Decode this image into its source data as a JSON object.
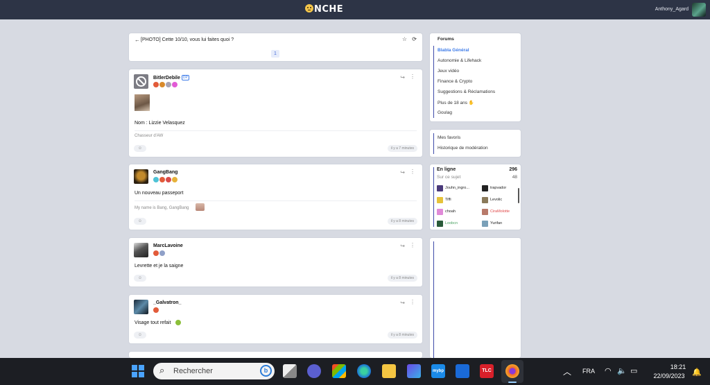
{
  "header": {
    "logo": "NCHE",
    "username": "Anthony_Agard"
  },
  "topic": {
    "back": "←",
    "title": "[PHOTO] Cette 10/10, vous lui faites quoi ?",
    "page": "1",
    "star": "☆",
    "refresh": "⟳"
  },
  "posts": [
    {
      "author": "BitlerDebile",
      "badge": "DP",
      "text": "Nom : Lizzie Velasquez",
      "signature": "Chasseur d'AW",
      "time": "il y a 7 minutes"
    },
    {
      "author": "GangBang",
      "text": "Un nouveau passeport",
      "signature": "My name is Bang, GangBang",
      "time": "il y a 8 minutes"
    },
    {
      "author": "MarcLavoine",
      "text": "Levrette et je la saigne",
      "time": "il y a 8 minutes"
    },
    {
      "author": "_Galvatron_",
      "text": "Visage tout refait",
      "time": "il y a 8 minutes"
    }
  ],
  "icons": {
    "share": "↪",
    "more": "⋮",
    "react": "☺"
  },
  "forums": {
    "heading": "Forums",
    "items": [
      "Blabla Général",
      "Autonomie & Lifehack",
      "Jeux vidéo",
      "Finance & Crypto",
      "Suggestions & Réclamations",
      "Plus de 18 ans",
      "Goulag"
    ],
    "plus18_emoji": "✋"
  },
  "links": {
    "items": [
      "Mes favoris",
      "Historique de modération"
    ]
  },
  "online": {
    "label": "En ligne",
    "count": "296",
    "site_label": "Sur ce sujet",
    "site_count": "48",
    "users": [
      "Jouhn_ingro...",
      "trapvador",
      "Tiffi",
      "Levolic",
      "choah",
      "CiraMolotte",
      "Loobcn",
      "Yurifan"
    ]
  },
  "taskbar": {
    "search_placeholder": "Rechercher",
    "bing": "b",
    "lang": "FRA",
    "time": "18:21",
    "date": "22/09/2023",
    "apps": {
      "mybp": "mybp",
      "tlc": "TLC"
    },
    "icons": {
      "chevron": "︿",
      "wifi": "◠",
      "volume": "🔈",
      "battery": "▭",
      "notif": "🔔"
    }
  }
}
